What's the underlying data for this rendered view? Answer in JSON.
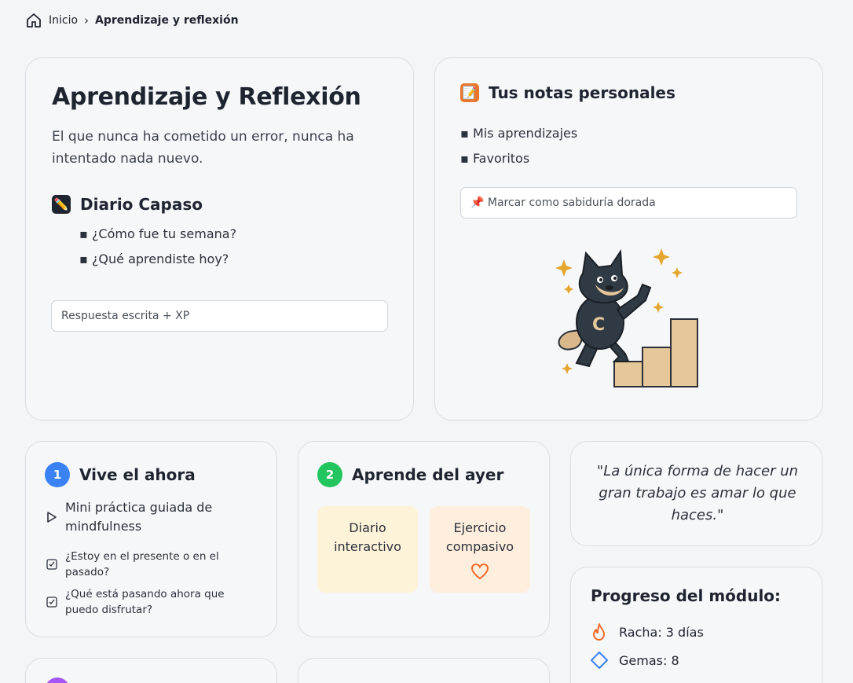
{
  "breadcrumb": {
    "home": "Inicio",
    "current": "Aprendizaje y reflexión"
  },
  "main": {
    "title": "Aprendizaje y Reflexión",
    "quote": "El que nunca ha cometido un error, nunca ha intentado nada nuevo.",
    "diary": {
      "title": "Diario Capaso",
      "questions": [
        "¿Cómo fue tu semana?",
        "¿Qué aprendiste hoy?"
      ],
      "input_placeholder": "Respuesta escrita + XP"
    }
  },
  "notes": {
    "title": "Tus notas personales",
    "items": [
      "Mis aprendizajes",
      "Favoritos"
    ],
    "input_placeholder": "📌 Marcar como sabiduría dorada"
  },
  "vive": {
    "number": "1",
    "title": "Vive el ahora",
    "practice": "Mini práctica guiada de mindfulness",
    "checks": [
      "¿Estoy en el presente o en el pasado?",
      "¿Qué está pasando ahora que puedo disfrutar?"
    ]
  },
  "ayer": {
    "number": "2",
    "title": "Aprende del ayer",
    "tiles": [
      "Diario interactivo",
      "Ejercicio compasivo"
    ]
  },
  "quote_card": {
    "text": "\"La única forma de hacer un gran trabajo es amar lo que haces.\""
  },
  "progress": {
    "title": "Progreso del módulo:",
    "streak": "Racha: 3 días",
    "gems": "Gemas: 8"
  },
  "colors": {
    "blue": "#3b82f6",
    "green": "#22c55e",
    "purple": "#a855f7",
    "orange": "#f26b2a",
    "tile_yellow": "#fdf3d8",
    "tile_peach": "#fdeedd"
  }
}
